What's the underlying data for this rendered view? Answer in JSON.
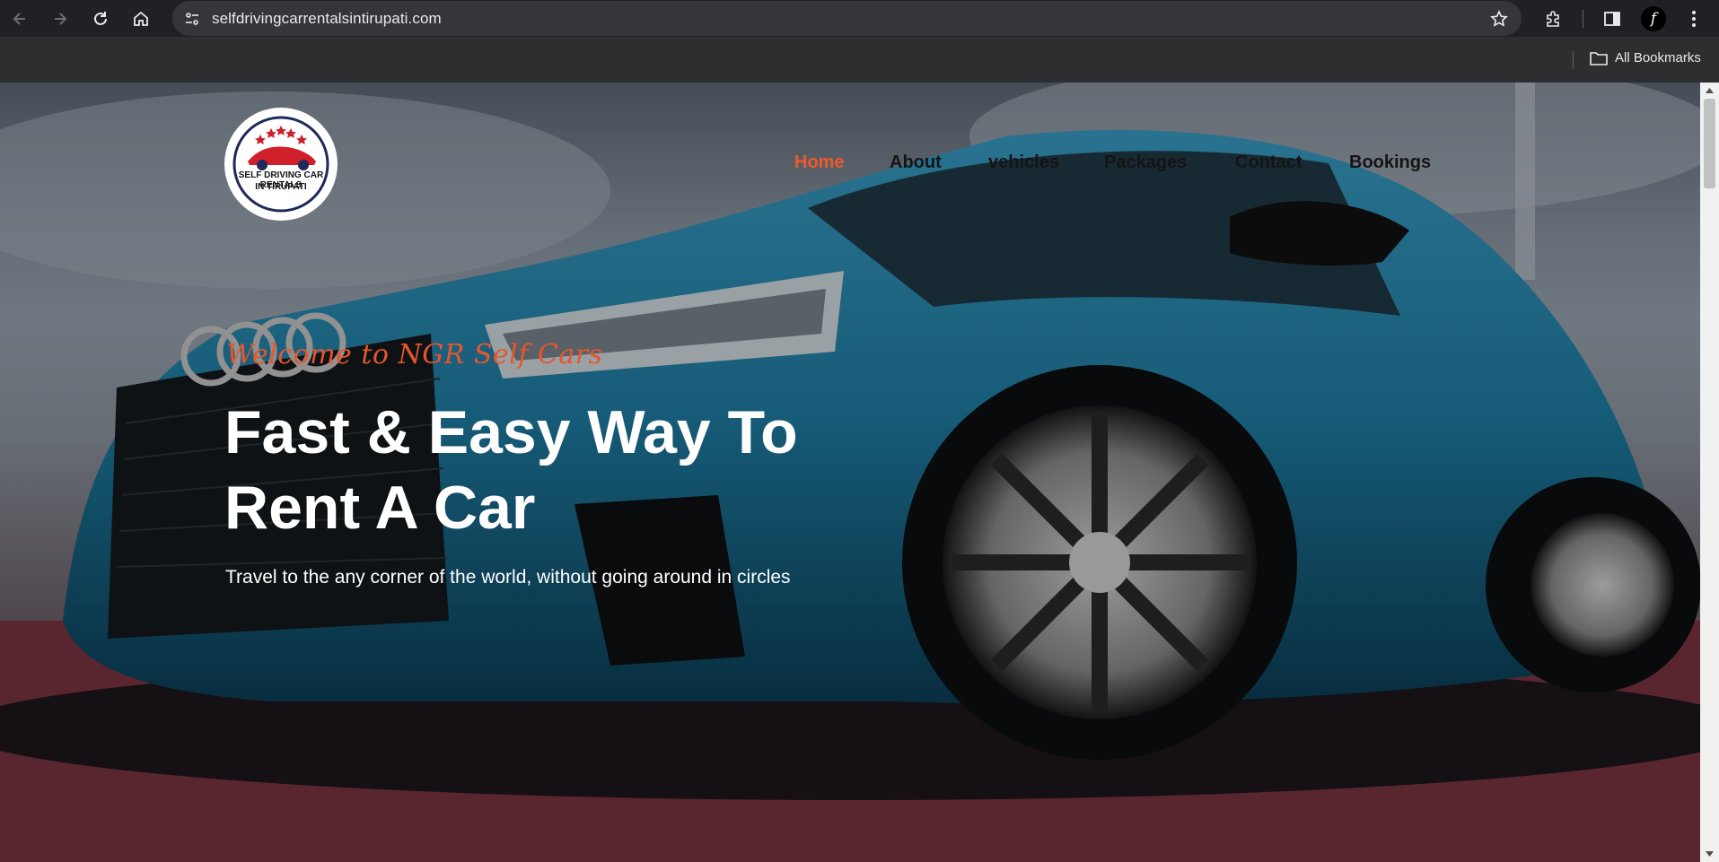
{
  "browser": {
    "url": "selfdrivingcarrentalsintirupati.com",
    "bookmarks_label": "All Bookmarks",
    "profile_initial": "f",
    "icons": [
      "back-arrow-icon",
      "forward-arrow-icon",
      "reload-icon",
      "home-icon",
      "site-info-icon",
      "bookmark-star-icon",
      "extensions-icon",
      "side-panel-icon",
      "kebab-menu-icon",
      "folder-icon"
    ]
  },
  "site": {
    "logo": {
      "line1": "SELF DRIVING CAR RENTALS",
      "line2": "IN TIRUPATI"
    },
    "nav": [
      {
        "label": "Home",
        "active": true
      },
      {
        "label": "About",
        "active": false
      },
      {
        "label": "vehicles",
        "active": false
      },
      {
        "label": "Packages",
        "active": false
      },
      {
        "label": "Contact",
        "active": false
      },
      {
        "label": "Bookings",
        "active": false
      }
    ],
    "hero": {
      "welcome": "Welcome to NGR Self Cars",
      "headline": "Fast & Easy Way To Rent A Car",
      "subtitle": "Travel to the any corner of the world, without going around in circles"
    },
    "colors": {
      "accent": "#f1592a",
      "welcome": "#e8552c",
      "nav_text": "#141414",
      "car_body": "#1f7fa6"
    }
  }
}
